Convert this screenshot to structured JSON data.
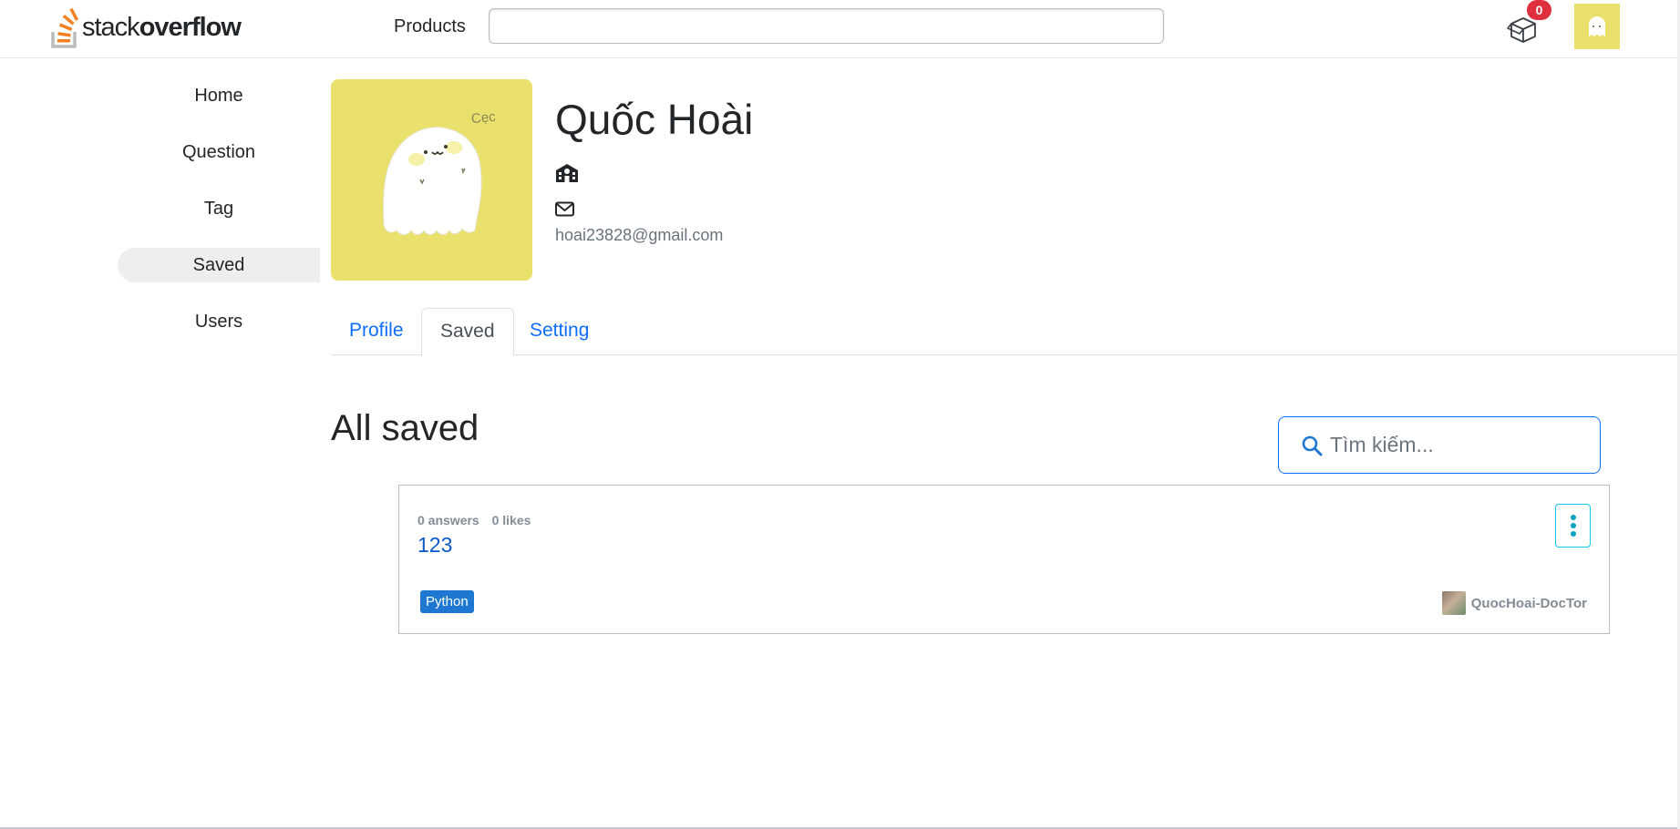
{
  "header": {
    "logo_light": "stack",
    "logo_bold": "overflow",
    "products_label": "Products",
    "search_placeholder": "",
    "inbox_count": "0"
  },
  "sidebar": {
    "items": [
      {
        "label": "Home"
      },
      {
        "label": "Question"
      },
      {
        "label": "Tag"
      },
      {
        "label": "Saved"
      },
      {
        "label": "Users"
      }
    ],
    "active": "Saved"
  },
  "profile": {
    "name": "Quốc Hoài",
    "email": "hoai23828@gmail.com",
    "photo_caption": "Cẹc"
  },
  "tabs": [
    {
      "label": "Profile"
    },
    {
      "label": "Saved"
    },
    {
      "label": "Setting"
    }
  ],
  "saved": {
    "title": "All saved",
    "search_placeholder": "Tìm kiếm...",
    "items": [
      {
        "answers": "0 answers",
        "likes": "0 likes",
        "title": "123",
        "tag": "Python",
        "author": "QuocHoai-DocTor"
      }
    ]
  },
  "colors": {
    "accent": "#0d6efd",
    "brand_orange": "#f48024",
    "avatar_bg": "#eae06c",
    "badge": "#de2f3c",
    "tag": "#1e78d1"
  }
}
